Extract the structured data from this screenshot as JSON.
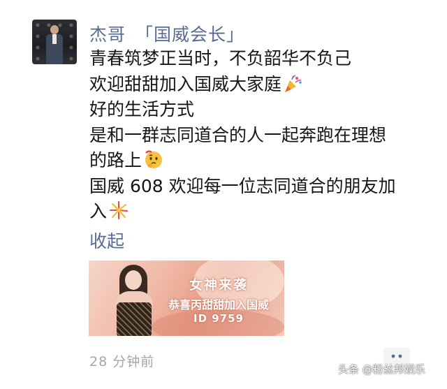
{
  "author": {
    "name": "杰哥",
    "title": "「国威会长」"
  },
  "post": {
    "lines": [
      "青春筑梦正当时，不负韶华不负己",
      "欢迎甜甜加入国威大家庭",
      "好的生活方式",
      "是和一群志同道合的人一起奔跑在理想",
      "的路上",
      "国威 608 欢迎每一位志同道合的朋友加",
      "入"
    ],
    "emojis": [
      "party-popper-icon",
      "thinking-face-icon",
      "fireworks-icon"
    ]
  },
  "collapse_label": "收起",
  "link_card": {
    "line1": "女神来袭",
    "line2": "恭喜丙甜甜加入国威",
    "line3": "ID 9759"
  },
  "timestamp": "28 分钟前",
  "watermark": "头条 @粉丝邦娱乐",
  "colors": {
    "link_blue": "#576b95",
    "text": "#161616",
    "muted": "#a6a6a6"
  }
}
